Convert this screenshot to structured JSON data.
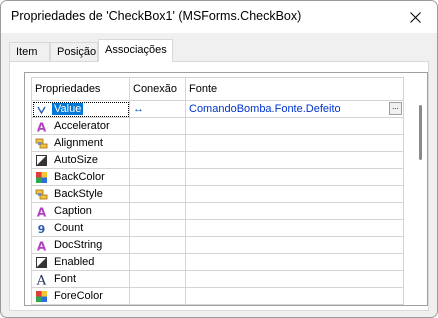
{
  "window": {
    "title": "Propriedades de 'CheckBox1' (MSForms.CheckBox)"
  },
  "tabs": [
    {
      "label": "Item",
      "active": false
    },
    {
      "label": "Posição",
      "active": false
    },
    {
      "label": "Associações",
      "active": true
    }
  ],
  "grid": {
    "headers": {
      "property": "Propriedades",
      "connection": "Conexão",
      "source": "Fonte"
    },
    "rows": [
      {
        "icon": "variable-icon",
        "name": "Value",
        "connection": "↔",
        "source": "ComandoBomba.Fonte.Defeito",
        "selected": true
      },
      {
        "icon": "text-a-icon",
        "name": "Accelerator",
        "connection": "",
        "source": ""
      },
      {
        "icon": "alignment-icon",
        "name": "Alignment",
        "connection": "",
        "source": ""
      },
      {
        "icon": "boolean-icon",
        "name": "AutoSize",
        "connection": "",
        "source": ""
      },
      {
        "icon": "color-icon",
        "name": "BackColor",
        "connection": "",
        "source": ""
      },
      {
        "icon": "alignment-icon",
        "name": "BackStyle",
        "connection": "",
        "source": ""
      },
      {
        "icon": "text-a-icon",
        "name": "Caption",
        "connection": "",
        "source": ""
      },
      {
        "icon": "number-9-icon",
        "name": "Count",
        "connection": "",
        "source": ""
      },
      {
        "icon": "text-a-icon",
        "name": "DocString",
        "connection": "",
        "source": ""
      },
      {
        "icon": "boolean-icon",
        "name": "Enabled",
        "connection": "",
        "source": ""
      },
      {
        "icon": "font-icon",
        "name": "Font",
        "connection": "",
        "source": ""
      },
      {
        "icon": "color-icon",
        "name": "ForeColor",
        "connection": "",
        "source": ""
      }
    ]
  },
  "colors": {
    "selection": "#0078d7",
    "link_text": "#0033cc"
  }
}
